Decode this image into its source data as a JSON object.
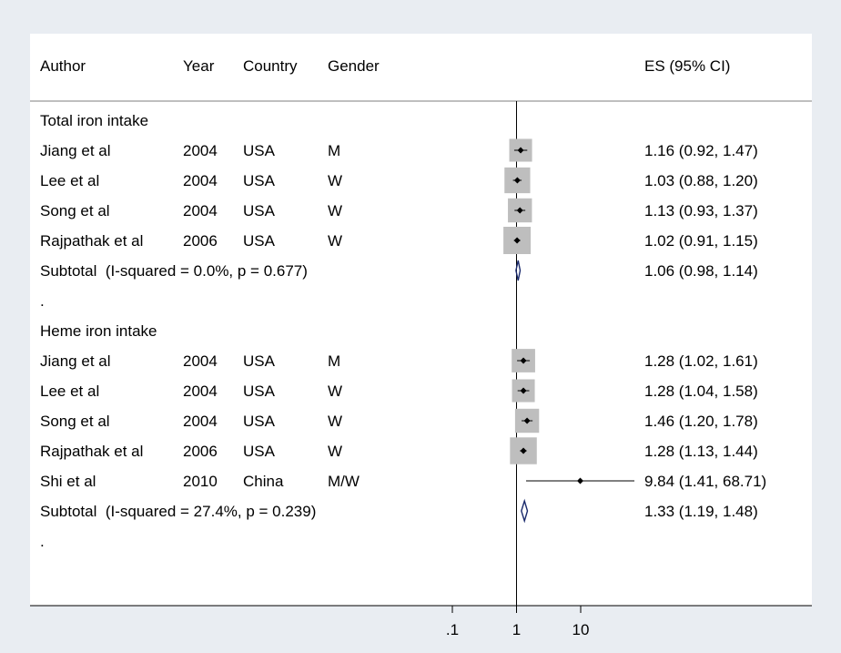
{
  "chart_data": {
    "type": "forest",
    "x_scale": "log",
    "xlim": [
      0.1,
      10
    ],
    "xticks": [
      ".1",
      "1",
      "10"
    ],
    "null_line": 1,
    "headers": {
      "author": "Author",
      "year": "Year",
      "country": "Country",
      "gender": "Gender",
      "es": "ES (95% CI)"
    },
    "rows": [
      {
        "kind": "group",
        "label": "Total iron intake"
      },
      {
        "kind": "study",
        "author": "Jiang et al",
        "year": "2004",
        "country": "USA",
        "gender": "M",
        "es": 1.16,
        "lo": 0.92,
        "hi": 1.47,
        "weight": 0.6,
        "es_text": "1.16 (0.92, 1.47)"
      },
      {
        "kind": "study",
        "author": "Lee et al",
        "year": "2004",
        "country": "USA",
        "gender": "W",
        "es": 1.03,
        "lo": 0.88,
        "hi": 1.2,
        "weight": 0.85,
        "es_text": "1.03 (0.88, 1.20)"
      },
      {
        "kind": "study",
        "author": "Song et al",
        "year": "2004",
        "country": "USA",
        "gender": "W",
        "es": 1.13,
        "lo": 0.93,
        "hi": 1.37,
        "weight": 0.7,
        "es_text": "1.13 (0.93, 1.37)"
      },
      {
        "kind": "study",
        "author": "Rajpathak et al",
        "year": "2006",
        "country": "USA",
        "gender": "W",
        "es": 1.02,
        "lo": 0.91,
        "hi": 1.15,
        "weight": 1.0,
        "es_text": "1.02 (0.91, 1.15)"
      },
      {
        "kind": "subtotal",
        "label": "Subtotal  (I-squared = 0.0%, p = 0.677)",
        "es": 1.06,
        "lo": 0.98,
        "hi": 1.14,
        "es_text": "1.06 (0.98, 1.14)"
      },
      {
        "kind": "blank",
        "label": "."
      },
      {
        "kind": "group",
        "label": "Heme iron intake"
      },
      {
        "kind": "study",
        "author": "Jiang et al",
        "year": "2004",
        "country": "USA",
        "gender": "M",
        "es": 1.28,
        "lo": 1.02,
        "hi": 1.61,
        "weight": 0.65,
        "es_text": "1.28 (1.02, 1.61)"
      },
      {
        "kind": "study",
        "author": "Lee et al",
        "year": "2004",
        "country": "USA",
        "gender": "W",
        "es": 1.28,
        "lo": 1.04,
        "hi": 1.58,
        "weight": 0.6,
        "es_text": "1.28 (1.04, 1.58)"
      },
      {
        "kind": "study",
        "author": "Song et al",
        "year": "2004",
        "country": "USA",
        "gender": "W",
        "es": 1.46,
        "lo": 1.2,
        "hi": 1.78,
        "weight": 0.7,
        "es_text": "1.46 (1.20, 1.78)"
      },
      {
        "kind": "study",
        "author": "Rajpathak et al",
        "year": "2006",
        "country": "USA",
        "gender": "W",
        "es": 1.28,
        "lo": 1.13,
        "hi": 1.44,
        "weight": 0.95,
        "es_text": "1.28 (1.13, 1.44)"
      },
      {
        "kind": "study",
        "author": "Shi et al",
        "year": "2010",
        "country": "China",
        "gender": "M/W",
        "es": 9.84,
        "lo": 1.41,
        "hi": 68.71,
        "weight": 0.0,
        "es_text": "9.84 (1.41, 68.71)"
      },
      {
        "kind": "subtotal",
        "label": "Subtotal  (I-squared = 27.4%, p = 0.239)",
        "es": 1.33,
        "lo": 1.19,
        "hi": 1.48,
        "es_text": "1.33 (1.19, 1.48)"
      },
      {
        "kind": "blank",
        "label": "."
      }
    ],
    "colors": {
      "background": "#e9edf2",
      "plot_background": "#ffffff",
      "weight_box": "#bebebe",
      "diamond": "#1a2a6c",
      "line": "#000000"
    }
  }
}
